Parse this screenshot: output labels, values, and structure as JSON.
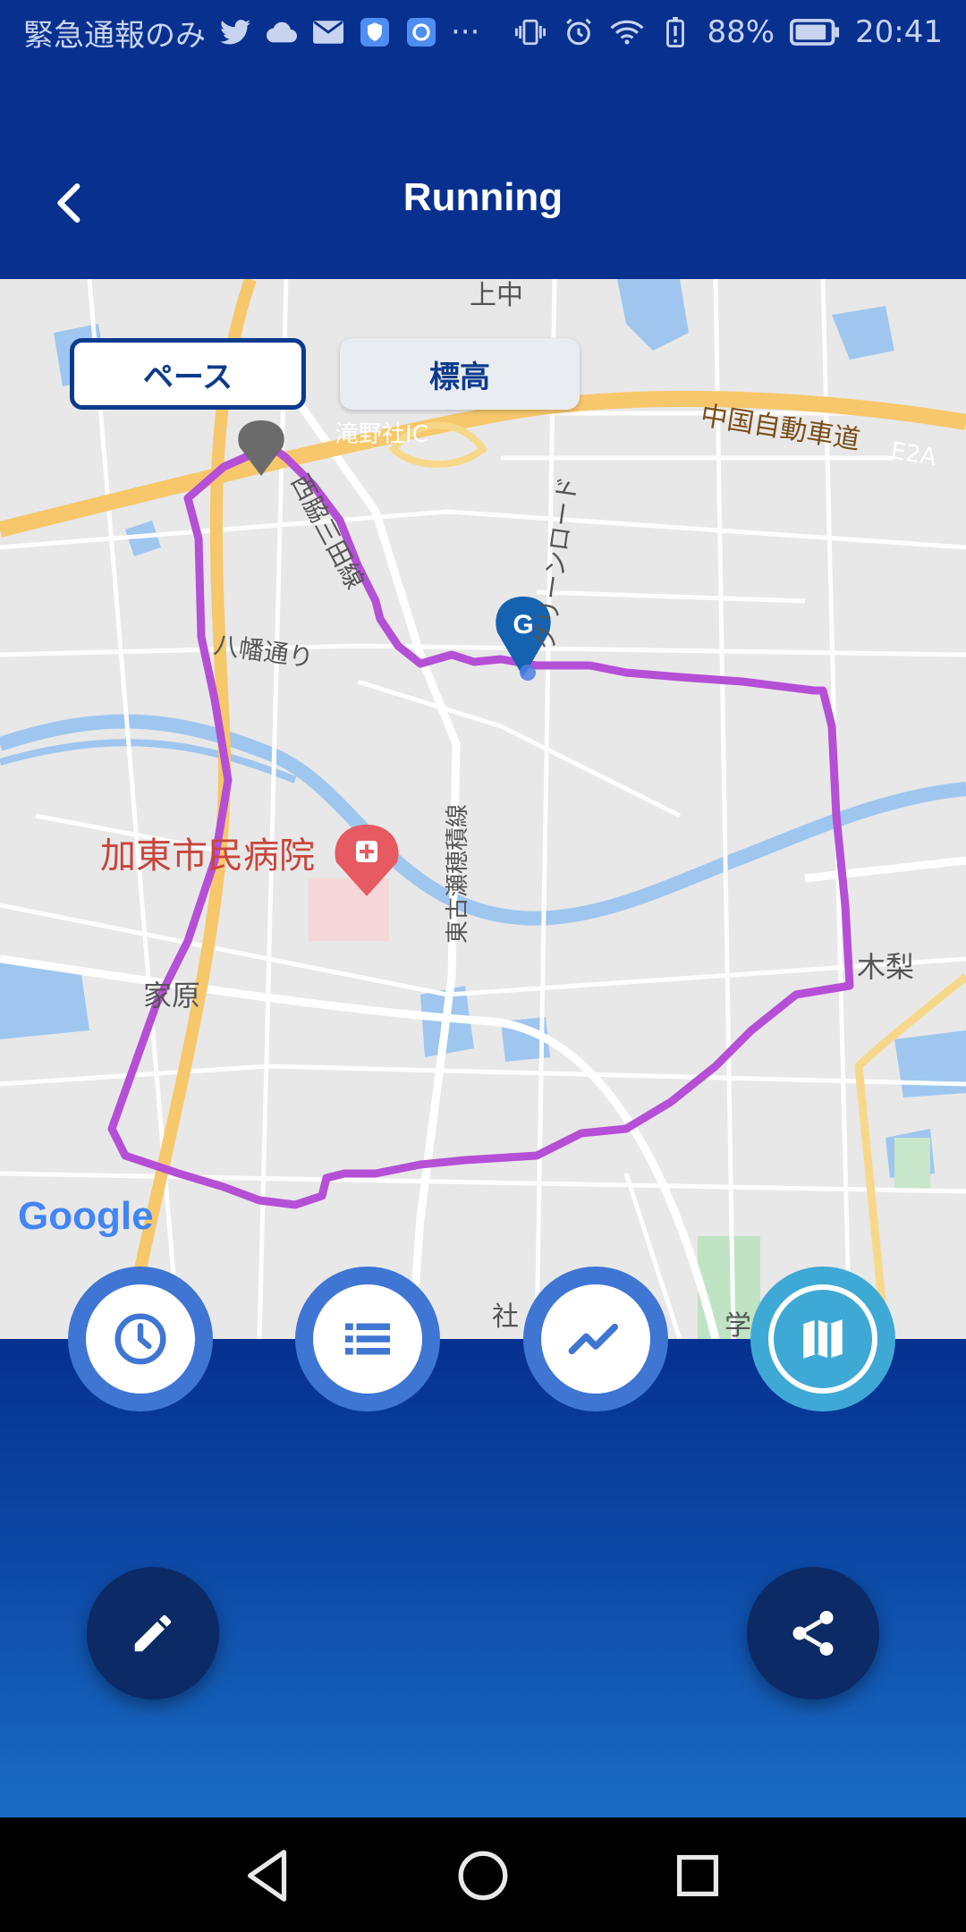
{
  "status_bar": {
    "carrier_text": "緊急通報のみ",
    "icons_left": [
      "twitter-icon",
      "cloud-icon",
      "mail-icon",
      "shield-icon",
      "app-icon",
      "more-icon"
    ],
    "more": "···",
    "icons_right": [
      "vibrate-icon",
      "alarm-icon",
      "wifi-icon",
      "battery-alert-icon"
    ],
    "battery": "88%",
    "time": "20:41"
  },
  "header": {
    "title": "Running"
  },
  "map": {
    "toggle": {
      "pace": "ペース",
      "elevation": "標高"
    },
    "labels": {
      "kaminaka": "上中",
      "chugoku_expressway": "中国自動車道",
      "e2a": "E2A",
      "takinoyashiro_ic": "滝野社IC",
      "nishiwaki_sanda_line": "西脇三田線",
      "green_road": "グリーンロード",
      "hachiman_dori": "八幡通り",
      "higashi_kose_line": "東古瀬穂積線",
      "hospital": "加東市民病院",
      "ieharu": "家原",
      "kinashi": "木梨",
      "yashiro": "社",
      "gaku": "学"
    },
    "goal_marker": "G",
    "attribution": "Google",
    "route_color": "#b54fd6"
  },
  "tabs": [
    {
      "name": "tab-time",
      "icon": "clock-icon"
    },
    {
      "name": "tab-laps",
      "icon": "list-icon"
    },
    {
      "name": "tab-chart",
      "icon": "trend-icon"
    },
    {
      "name": "tab-map",
      "icon": "map-icon",
      "active": true
    }
  ],
  "actions": {
    "edit": "pencil-icon",
    "share": "share-icon"
  },
  "colors": {
    "header_bg": "#08308f",
    "tab_ring": "#3f76d4",
    "active_tab": "#3fa9d6",
    "action_bg": "#0b2a66"
  }
}
